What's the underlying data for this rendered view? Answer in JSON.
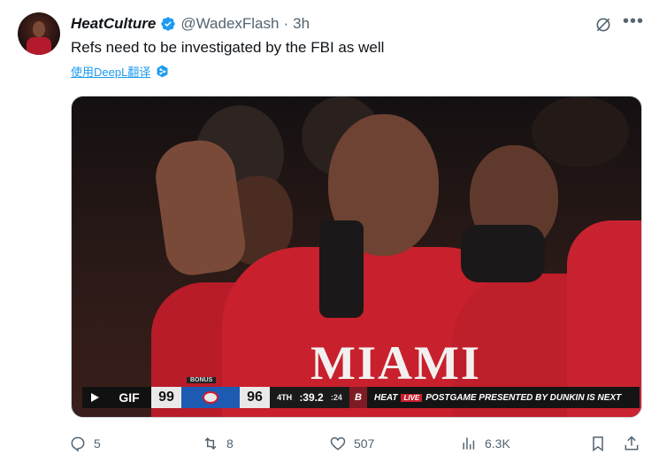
{
  "author": {
    "display_name": "HeatCulture",
    "handle": "@WadexFlash",
    "separator": "·",
    "time": "3h",
    "verified": true
  },
  "tweet": {
    "text": "Refs need to be investigated by the FBI as well",
    "translate_label": "使用DeepL翻译"
  },
  "media": {
    "type": "GIF",
    "gif_label": "GIF",
    "jersey_text": "MIAMI",
    "scoreboard": {
      "bonus_label": "BONUS",
      "heat_score": "99",
      "sixers_score": "96",
      "quarter": "4TH",
      "game_clock": ":39.2",
      "shot_clock": ":24",
      "brand_mark": "B",
      "ticker_team": "HEAT",
      "ticker_live": "LIVE",
      "ticker_text": "POSTGAME PRESENTED BY DUNKIN IS NEXT"
    }
  },
  "actions": {
    "replies": "5",
    "reposts": "8",
    "likes": "507",
    "views": "6.3K"
  },
  "colors": {
    "accent": "#1d9bf0",
    "muted": "#536471",
    "heat_red": "#c8202d",
    "sixers_blue": "#1d5bb3"
  },
  "icons": [
    "grok-icon",
    "more-icon",
    "verified-badge-icon",
    "deepl-icon",
    "play-icon",
    "reply-icon",
    "repost-icon",
    "like-icon",
    "views-icon",
    "bookmark-icon",
    "share-icon"
  ]
}
